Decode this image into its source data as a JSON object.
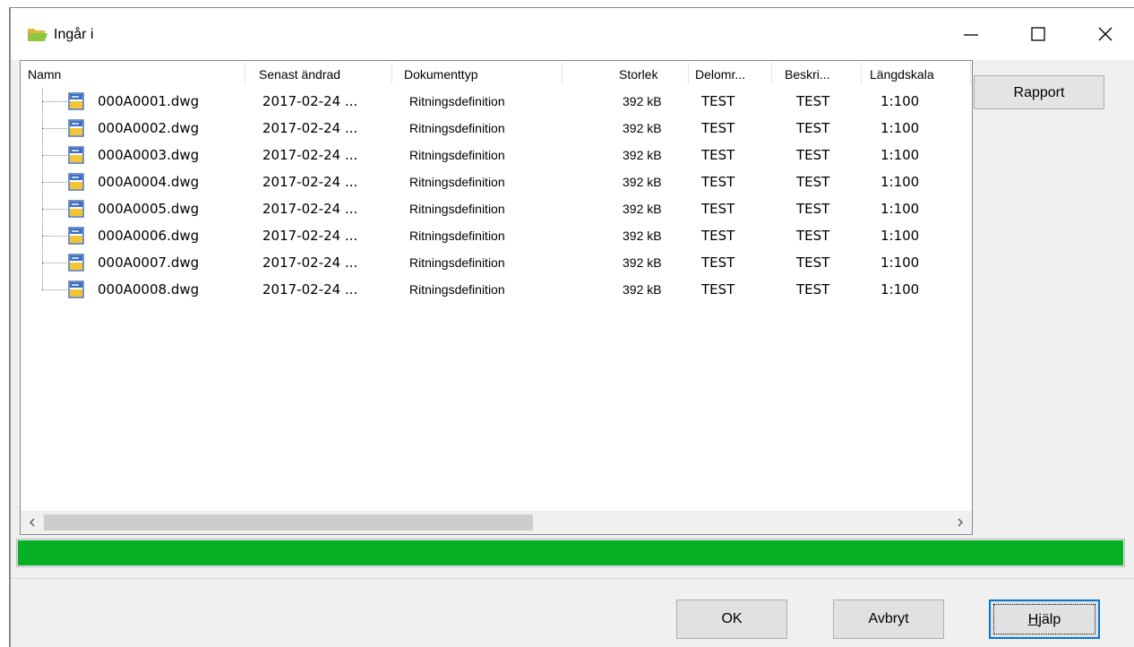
{
  "window": {
    "title": "Ingår i",
    "icon": "folder-open-icon",
    "controls": [
      "minimize-icon",
      "maximize-icon",
      "close-icon"
    ]
  },
  "list": {
    "columns": [
      "Namn",
      "Senast ändrad",
      "Dokumenttyp",
      "Storlek",
      "Delomr...",
      "Beskri...",
      "Längdskala"
    ],
    "rows": [
      {
        "name": "000A0001.dwg",
        "modified": "2017-02-24 ...",
        "type": "Ritningsdefinition",
        "size": "392 kB",
        "area": "TEST",
        "desc": "TEST",
        "scale": "1:100"
      },
      {
        "name": "000A0002.dwg",
        "modified": "2017-02-24 ...",
        "type": "Ritningsdefinition",
        "size": "392 kB",
        "area": "TEST",
        "desc": "TEST",
        "scale": "1:100"
      },
      {
        "name": "000A0003.dwg",
        "modified": "2017-02-24 ...",
        "type": "Ritningsdefinition",
        "size": "392 kB",
        "area": "TEST",
        "desc": "TEST",
        "scale": "1:100"
      },
      {
        "name": "000A0004.dwg",
        "modified": "2017-02-24 ...",
        "type": "Ritningsdefinition",
        "size": "392 kB",
        "area": "TEST",
        "desc": "TEST",
        "scale": "1:100"
      },
      {
        "name": "000A0005.dwg",
        "modified": "2017-02-24 ...",
        "type": "Ritningsdefinition",
        "size": "392 kB",
        "area": "TEST",
        "desc": "TEST",
        "scale": "1:100"
      },
      {
        "name": "000A0006.dwg",
        "modified": "2017-02-24 ...",
        "type": "Ritningsdefinition",
        "size": "392 kB",
        "area": "TEST",
        "desc": "TEST",
        "scale": "1:100"
      },
      {
        "name": "000A0007.dwg",
        "modified": "2017-02-24 ...",
        "type": "Ritningsdefinition",
        "size": "392 kB",
        "area": "TEST",
        "desc": "TEST",
        "scale": "1:100"
      },
      {
        "name": "000A0008.dwg",
        "modified": "2017-02-24 ...",
        "type": "Ritningsdefinition",
        "size": "392 kB",
        "area": "TEST",
        "desc": "TEST",
        "scale": "1:100"
      }
    ],
    "row_icon": "dwg-file-icon"
  },
  "side": {
    "report_tab": "Rapport"
  },
  "progress": {
    "value": 1.0,
    "color": "#06b025"
  },
  "buttons": {
    "ok": "OK",
    "cancel": "Avbryt",
    "help_first": "H",
    "help_rest": "jälp"
  }
}
